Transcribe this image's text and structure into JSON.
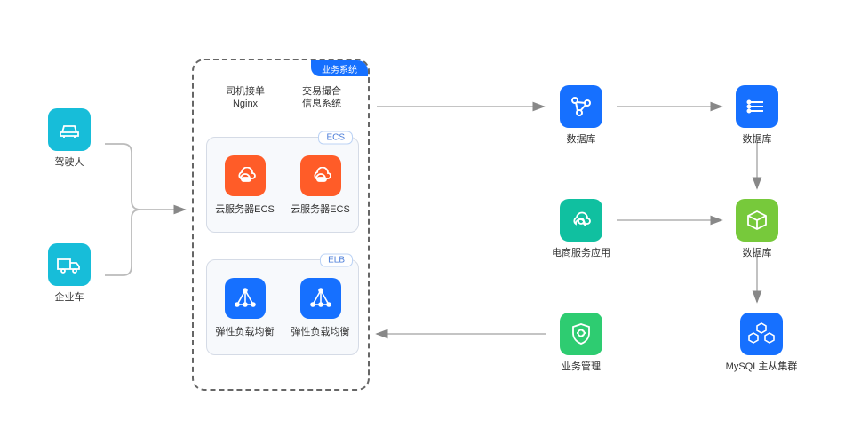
{
  "left": {
    "car_label": "驾驶人",
    "truck_label": "企业车"
  },
  "panel": {
    "tab": "业务系统",
    "header": {
      "col1_line1": "司机接单",
      "col1_line2": "Nginx",
      "col2_line1": "交易撮合",
      "col2_line2": "信息系统"
    },
    "group_ecs": {
      "badge": "ECS",
      "item1": "云服务器ECS",
      "item2": "云服务器ECS"
    },
    "group_elb": {
      "badge": "ELB",
      "item1": "弹性负载均衡",
      "item2": "弹性负载均衡"
    }
  },
  "right": {
    "r1c1": "数据库",
    "r1c2": "数据库",
    "r2c1": "电商服务应用",
    "r2c2": "数据库",
    "r3c1": "业务管理",
    "r3c2": "MySQL主从集群"
  }
}
